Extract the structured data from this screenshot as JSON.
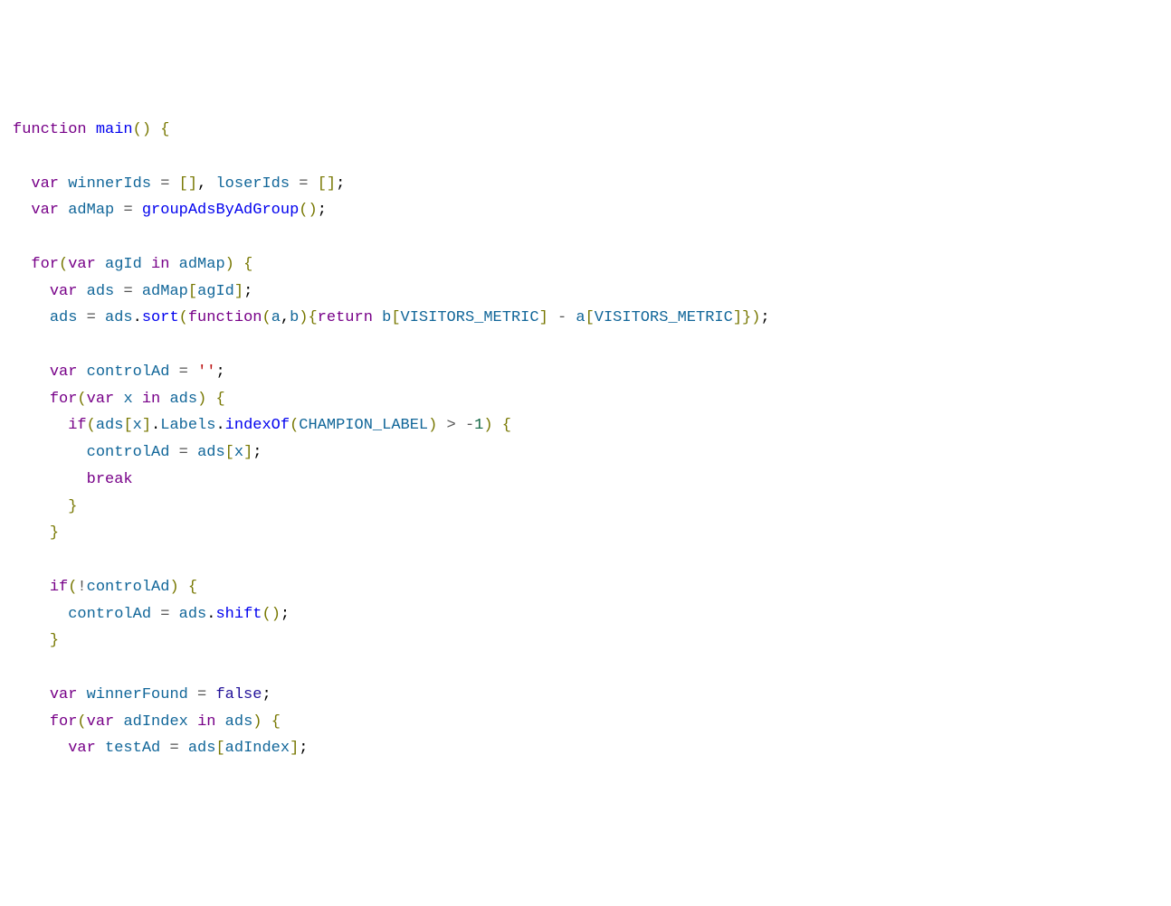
{
  "code": {
    "tokens": [
      {
        "t": "function ",
        "c": "kw"
      },
      {
        "t": "main",
        "c": "fn"
      },
      {
        "t": "(",
        "c": "br"
      },
      {
        "t": ")",
        "c": "br"
      },
      {
        "t": " ",
        "c": ""
      },
      {
        "t": "{",
        "c": "br"
      },
      {
        "t": "\n",
        "c": ""
      },
      {
        "t": "\n",
        "c": ""
      },
      {
        "t": "  ",
        "c": ""
      },
      {
        "t": "var ",
        "c": "kw"
      },
      {
        "t": "winnerIds",
        "c": "id"
      },
      {
        "t": " ",
        "c": ""
      },
      {
        "t": "=",
        "c": "op"
      },
      {
        "t": " ",
        "c": ""
      },
      {
        "t": "[",
        "c": "br"
      },
      {
        "t": "]",
        "c": "br"
      },
      {
        "t": ",",
        "c": ""
      },
      {
        "t": " ",
        "c": ""
      },
      {
        "t": "loserIds",
        "c": "id"
      },
      {
        "t": " ",
        "c": ""
      },
      {
        "t": "=",
        "c": "op"
      },
      {
        "t": " ",
        "c": ""
      },
      {
        "t": "[",
        "c": "br"
      },
      {
        "t": "]",
        "c": "br"
      },
      {
        "t": ";",
        "c": ""
      },
      {
        "t": "\n",
        "c": ""
      },
      {
        "t": "  ",
        "c": ""
      },
      {
        "t": "var ",
        "c": "kw"
      },
      {
        "t": "adMap",
        "c": "id"
      },
      {
        "t": " ",
        "c": ""
      },
      {
        "t": "=",
        "c": "op"
      },
      {
        "t": " ",
        "c": ""
      },
      {
        "t": "groupAdsByAdGroup",
        "c": "fn"
      },
      {
        "t": "(",
        "c": "br"
      },
      {
        "t": ")",
        "c": "br"
      },
      {
        "t": ";",
        "c": ""
      },
      {
        "t": "\n",
        "c": ""
      },
      {
        "t": "\n",
        "c": ""
      },
      {
        "t": "  ",
        "c": ""
      },
      {
        "t": "for",
        "c": "kw"
      },
      {
        "t": "(",
        "c": "br"
      },
      {
        "t": "var ",
        "c": "kw"
      },
      {
        "t": "agId",
        "c": "id"
      },
      {
        "t": " ",
        "c": ""
      },
      {
        "t": "in",
        "c": "kw"
      },
      {
        "t": " ",
        "c": ""
      },
      {
        "t": "adMap",
        "c": "id"
      },
      {
        "t": ")",
        "c": "br"
      },
      {
        "t": " ",
        "c": ""
      },
      {
        "t": "{",
        "c": "br"
      },
      {
        "t": "\n",
        "c": ""
      },
      {
        "t": "    ",
        "c": ""
      },
      {
        "t": "var ",
        "c": "kw"
      },
      {
        "t": "ads",
        "c": "id"
      },
      {
        "t": " ",
        "c": ""
      },
      {
        "t": "=",
        "c": "op"
      },
      {
        "t": " ",
        "c": ""
      },
      {
        "t": "adMap",
        "c": "id"
      },
      {
        "t": "[",
        "c": "br"
      },
      {
        "t": "agId",
        "c": "id"
      },
      {
        "t": "]",
        "c": "br"
      },
      {
        "t": ";",
        "c": ""
      },
      {
        "t": "\n",
        "c": ""
      },
      {
        "t": "    ",
        "c": ""
      },
      {
        "t": "ads",
        "c": "id"
      },
      {
        "t": " ",
        "c": ""
      },
      {
        "t": "=",
        "c": "op"
      },
      {
        "t": " ",
        "c": ""
      },
      {
        "t": "ads",
        "c": "id"
      },
      {
        "t": ".",
        "c": ""
      },
      {
        "t": "sort",
        "c": "fn"
      },
      {
        "t": "(",
        "c": "br"
      },
      {
        "t": "function",
        "c": "kw"
      },
      {
        "t": "(",
        "c": "br"
      },
      {
        "t": "a",
        "c": "id"
      },
      {
        "t": ",",
        "c": ""
      },
      {
        "t": "b",
        "c": "id"
      },
      {
        "t": ")",
        "c": "br"
      },
      {
        "t": "{",
        "c": "br"
      },
      {
        "t": "return ",
        "c": "kw"
      },
      {
        "t": "b",
        "c": "id"
      },
      {
        "t": "[",
        "c": "br"
      },
      {
        "t": "VISITORS_METRIC",
        "c": "id"
      },
      {
        "t": "]",
        "c": "br"
      },
      {
        "t": " ",
        "c": ""
      },
      {
        "t": "-",
        "c": "op"
      },
      {
        "t": " ",
        "c": ""
      },
      {
        "t": "a",
        "c": "id"
      },
      {
        "t": "[",
        "c": "br"
      },
      {
        "t": "VISITORS_METRIC",
        "c": "id"
      },
      {
        "t": "]",
        "c": "br"
      },
      {
        "t": "}",
        "c": "br"
      },
      {
        "t": ")",
        "c": "br"
      },
      {
        "t": ";",
        "c": ""
      },
      {
        "t": "\n",
        "c": ""
      },
      {
        "t": "\n",
        "c": ""
      },
      {
        "t": "    ",
        "c": ""
      },
      {
        "t": "var ",
        "c": "kw"
      },
      {
        "t": "controlAd",
        "c": "id"
      },
      {
        "t": " ",
        "c": ""
      },
      {
        "t": "=",
        "c": "op"
      },
      {
        "t": " ",
        "c": ""
      },
      {
        "t": "''",
        "c": "str"
      },
      {
        "t": ";",
        "c": ""
      },
      {
        "t": "\n",
        "c": ""
      },
      {
        "t": "    ",
        "c": ""
      },
      {
        "t": "for",
        "c": "kw"
      },
      {
        "t": "(",
        "c": "br"
      },
      {
        "t": "var ",
        "c": "kw"
      },
      {
        "t": "x",
        "c": "id"
      },
      {
        "t": " ",
        "c": ""
      },
      {
        "t": "in",
        "c": "kw"
      },
      {
        "t": " ",
        "c": ""
      },
      {
        "t": "ads",
        "c": "id"
      },
      {
        "t": ")",
        "c": "br"
      },
      {
        "t": " ",
        "c": ""
      },
      {
        "t": "{",
        "c": "br"
      },
      {
        "t": "\n",
        "c": ""
      },
      {
        "t": "      ",
        "c": ""
      },
      {
        "t": "if",
        "c": "kw"
      },
      {
        "t": "(",
        "c": "br"
      },
      {
        "t": "ads",
        "c": "id"
      },
      {
        "t": "[",
        "c": "br"
      },
      {
        "t": "x",
        "c": "id"
      },
      {
        "t": "]",
        "c": "br"
      },
      {
        "t": ".",
        "c": ""
      },
      {
        "t": "Labels",
        "c": "id"
      },
      {
        "t": ".",
        "c": ""
      },
      {
        "t": "indexOf",
        "c": "fn"
      },
      {
        "t": "(",
        "c": "br"
      },
      {
        "t": "CHAMPION_LABEL",
        "c": "id"
      },
      {
        "t": ")",
        "c": "br"
      },
      {
        "t": " ",
        "c": ""
      },
      {
        "t": ">",
        "c": "op"
      },
      {
        "t": " ",
        "c": ""
      },
      {
        "t": "-",
        "c": "op"
      },
      {
        "t": "1",
        "c": "num"
      },
      {
        "t": ")",
        "c": "br"
      },
      {
        "t": " ",
        "c": ""
      },
      {
        "t": "{",
        "c": "br"
      },
      {
        "t": "\n",
        "c": ""
      },
      {
        "t": "        ",
        "c": ""
      },
      {
        "t": "controlAd",
        "c": "id"
      },
      {
        "t": " ",
        "c": ""
      },
      {
        "t": "=",
        "c": "op"
      },
      {
        "t": " ",
        "c": ""
      },
      {
        "t": "ads",
        "c": "id"
      },
      {
        "t": "[",
        "c": "br"
      },
      {
        "t": "x",
        "c": "id"
      },
      {
        "t": "]",
        "c": "br"
      },
      {
        "t": ";",
        "c": ""
      },
      {
        "t": "\n",
        "c": ""
      },
      {
        "t": "        ",
        "c": ""
      },
      {
        "t": "break",
        "c": "kw"
      },
      {
        "t": "\n",
        "c": ""
      },
      {
        "t": "      ",
        "c": ""
      },
      {
        "t": "}",
        "c": "br"
      },
      {
        "t": "\n",
        "c": ""
      },
      {
        "t": "    ",
        "c": ""
      },
      {
        "t": "}",
        "c": "br"
      },
      {
        "t": "\n",
        "c": ""
      },
      {
        "t": "\n",
        "c": ""
      },
      {
        "t": "    ",
        "c": ""
      },
      {
        "t": "if",
        "c": "kw"
      },
      {
        "t": "(",
        "c": "br"
      },
      {
        "t": "!",
        "c": "op"
      },
      {
        "t": "controlAd",
        "c": "id"
      },
      {
        "t": ")",
        "c": "br"
      },
      {
        "t": " ",
        "c": ""
      },
      {
        "t": "{",
        "c": "br"
      },
      {
        "t": "\n",
        "c": ""
      },
      {
        "t": "      ",
        "c": ""
      },
      {
        "t": "controlAd",
        "c": "id"
      },
      {
        "t": " ",
        "c": ""
      },
      {
        "t": "=",
        "c": "op"
      },
      {
        "t": " ",
        "c": ""
      },
      {
        "t": "ads",
        "c": "id"
      },
      {
        "t": ".",
        "c": ""
      },
      {
        "t": "shift",
        "c": "fn"
      },
      {
        "t": "(",
        "c": "br"
      },
      {
        "t": ")",
        "c": "br"
      },
      {
        "t": ";",
        "c": ""
      },
      {
        "t": "\n",
        "c": ""
      },
      {
        "t": "    ",
        "c": ""
      },
      {
        "t": "}",
        "c": "br"
      },
      {
        "t": "\n",
        "c": ""
      },
      {
        "t": "\n",
        "c": ""
      },
      {
        "t": "    ",
        "c": ""
      },
      {
        "t": "var ",
        "c": "kw"
      },
      {
        "t": "winnerFound",
        "c": "id"
      },
      {
        "t": " ",
        "c": ""
      },
      {
        "t": "=",
        "c": "op"
      },
      {
        "t": " ",
        "c": ""
      },
      {
        "t": "false",
        "c": "bool"
      },
      {
        "t": ";",
        "c": ""
      },
      {
        "t": "\n",
        "c": ""
      },
      {
        "t": "    ",
        "c": ""
      },
      {
        "t": "for",
        "c": "kw"
      },
      {
        "t": "(",
        "c": "br"
      },
      {
        "t": "var ",
        "c": "kw"
      },
      {
        "t": "adIndex",
        "c": "id"
      },
      {
        "t": " ",
        "c": ""
      },
      {
        "t": "in",
        "c": "kw"
      },
      {
        "t": " ",
        "c": ""
      },
      {
        "t": "ads",
        "c": "id"
      },
      {
        "t": ")",
        "c": "br"
      },
      {
        "t": " ",
        "c": ""
      },
      {
        "t": "{",
        "c": "br"
      },
      {
        "t": "\n",
        "c": ""
      },
      {
        "t": "      ",
        "c": ""
      },
      {
        "t": "var ",
        "c": "kw"
      },
      {
        "t": "testAd",
        "c": "id"
      },
      {
        "t": " ",
        "c": ""
      },
      {
        "t": "=",
        "c": "op"
      },
      {
        "t": " ",
        "c": ""
      },
      {
        "t": "ads",
        "c": "id"
      },
      {
        "t": "[",
        "c": "br"
      },
      {
        "t": "adIndex",
        "c": "id"
      },
      {
        "t": "]",
        "c": "br"
      },
      {
        "t": ";",
        "c": ""
      }
    ]
  }
}
